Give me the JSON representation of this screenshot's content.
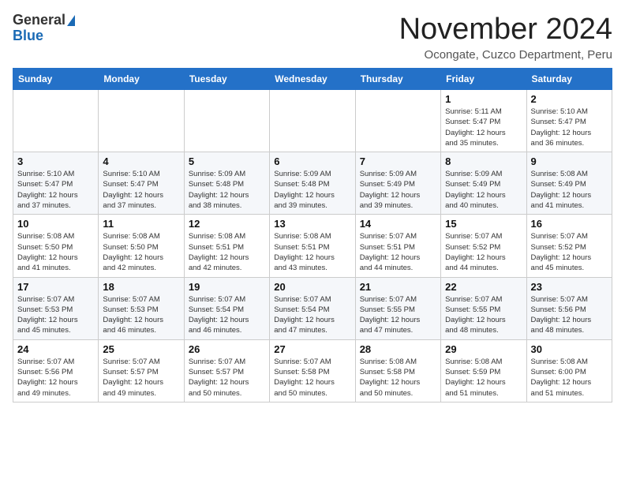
{
  "header": {
    "logo_general": "General",
    "logo_blue": "Blue",
    "month_title": "November 2024",
    "location": "Ocongate, Cuzco Department, Peru"
  },
  "days_of_week": [
    "Sunday",
    "Monday",
    "Tuesday",
    "Wednesday",
    "Thursday",
    "Friday",
    "Saturday"
  ],
  "weeks": [
    [
      {
        "day": "",
        "info": ""
      },
      {
        "day": "",
        "info": ""
      },
      {
        "day": "",
        "info": ""
      },
      {
        "day": "",
        "info": ""
      },
      {
        "day": "",
        "info": ""
      },
      {
        "day": "1",
        "info": "Sunrise: 5:11 AM\nSunset: 5:47 PM\nDaylight: 12 hours\nand 35 minutes."
      },
      {
        "day": "2",
        "info": "Sunrise: 5:10 AM\nSunset: 5:47 PM\nDaylight: 12 hours\nand 36 minutes."
      }
    ],
    [
      {
        "day": "3",
        "info": "Sunrise: 5:10 AM\nSunset: 5:47 PM\nDaylight: 12 hours\nand 37 minutes."
      },
      {
        "day": "4",
        "info": "Sunrise: 5:10 AM\nSunset: 5:47 PM\nDaylight: 12 hours\nand 37 minutes."
      },
      {
        "day": "5",
        "info": "Sunrise: 5:09 AM\nSunset: 5:48 PM\nDaylight: 12 hours\nand 38 minutes."
      },
      {
        "day": "6",
        "info": "Sunrise: 5:09 AM\nSunset: 5:48 PM\nDaylight: 12 hours\nand 39 minutes."
      },
      {
        "day": "7",
        "info": "Sunrise: 5:09 AM\nSunset: 5:49 PM\nDaylight: 12 hours\nand 39 minutes."
      },
      {
        "day": "8",
        "info": "Sunrise: 5:09 AM\nSunset: 5:49 PM\nDaylight: 12 hours\nand 40 minutes."
      },
      {
        "day": "9",
        "info": "Sunrise: 5:08 AM\nSunset: 5:49 PM\nDaylight: 12 hours\nand 41 minutes."
      }
    ],
    [
      {
        "day": "10",
        "info": "Sunrise: 5:08 AM\nSunset: 5:50 PM\nDaylight: 12 hours\nand 41 minutes."
      },
      {
        "day": "11",
        "info": "Sunrise: 5:08 AM\nSunset: 5:50 PM\nDaylight: 12 hours\nand 42 minutes."
      },
      {
        "day": "12",
        "info": "Sunrise: 5:08 AM\nSunset: 5:51 PM\nDaylight: 12 hours\nand 42 minutes."
      },
      {
        "day": "13",
        "info": "Sunrise: 5:08 AM\nSunset: 5:51 PM\nDaylight: 12 hours\nand 43 minutes."
      },
      {
        "day": "14",
        "info": "Sunrise: 5:07 AM\nSunset: 5:51 PM\nDaylight: 12 hours\nand 44 minutes."
      },
      {
        "day": "15",
        "info": "Sunrise: 5:07 AM\nSunset: 5:52 PM\nDaylight: 12 hours\nand 44 minutes."
      },
      {
        "day": "16",
        "info": "Sunrise: 5:07 AM\nSunset: 5:52 PM\nDaylight: 12 hours\nand 45 minutes."
      }
    ],
    [
      {
        "day": "17",
        "info": "Sunrise: 5:07 AM\nSunset: 5:53 PM\nDaylight: 12 hours\nand 45 minutes."
      },
      {
        "day": "18",
        "info": "Sunrise: 5:07 AM\nSunset: 5:53 PM\nDaylight: 12 hours\nand 46 minutes."
      },
      {
        "day": "19",
        "info": "Sunrise: 5:07 AM\nSunset: 5:54 PM\nDaylight: 12 hours\nand 46 minutes."
      },
      {
        "day": "20",
        "info": "Sunrise: 5:07 AM\nSunset: 5:54 PM\nDaylight: 12 hours\nand 47 minutes."
      },
      {
        "day": "21",
        "info": "Sunrise: 5:07 AM\nSunset: 5:55 PM\nDaylight: 12 hours\nand 47 minutes."
      },
      {
        "day": "22",
        "info": "Sunrise: 5:07 AM\nSunset: 5:55 PM\nDaylight: 12 hours\nand 48 minutes."
      },
      {
        "day": "23",
        "info": "Sunrise: 5:07 AM\nSunset: 5:56 PM\nDaylight: 12 hours\nand 48 minutes."
      }
    ],
    [
      {
        "day": "24",
        "info": "Sunrise: 5:07 AM\nSunset: 5:56 PM\nDaylight: 12 hours\nand 49 minutes."
      },
      {
        "day": "25",
        "info": "Sunrise: 5:07 AM\nSunset: 5:57 PM\nDaylight: 12 hours\nand 49 minutes."
      },
      {
        "day": "26",
        "info": "Sunrise: 5:07 AM\nSunset: 5:57 PM\nDaylight: 12 hours\nand 50 minutes."
      },
      {
        "day": "27",
        "info": "Sunrise: 5:07 AM\nSunset: 5:58 PM\nDaylight: 12 hours\nand 50 minutes."
      },
      {
        "day": "28",
        "info": "Sunrise: 5:08 AM\nSunset: 5:58 PM\nDaylight: 12 hours\nand 50 minutes."
      },
      {
        "day": "29",
        "info": "Sunrise: 5:08 AM\nSunset: 5:59 PM\nDaylight: 12 hours\nand 51 minutes."
      },
      {
        "day": "30",
        "info": "Sunrise: 5:08 AM\nSunset: 6:00 PM\nDaylight: 12 hours\nand 51 minutes."
      }
    ]
  ]
}
